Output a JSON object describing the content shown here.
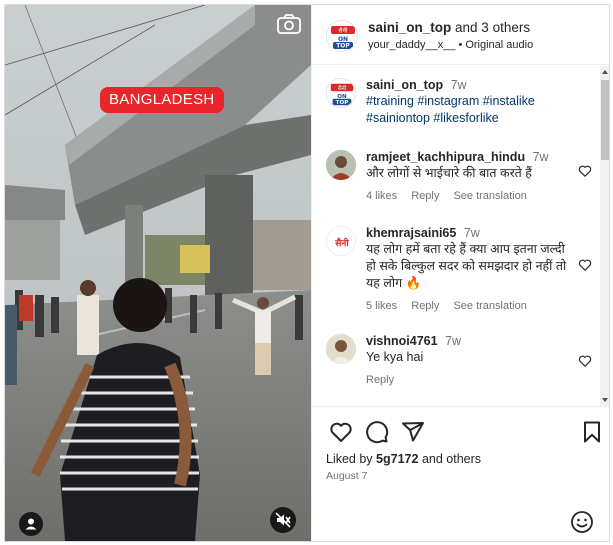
{
  "media": {
    "overlay_label": "BANGLADESH",
    "icons": [
      "camera-icon",
      "user-tag-icon",
      "mute-icon"
    ]
  },
  "header": {
    "username": "saini_on_top",
    "others_text": "and 3 others",
    "audio_user": "your_daddy__x__",
    "audio_separator": "•",
    "audio_label": "Original audio",
    "avatar_lines": [
      "सैनी",
      "ON",
      "TOP"
    ]
  },
  "caption": {
    "username": "saini_on_top",
    "time": "7w",
    "text": "#training #instagram #instalike #sainiontop #likesforlike"
  },
  "comments": [
    {
      "username": "ramjeet_kachhipura_hindu",
      "time": "7w",
      "text": "और लोगों से भाईचारे की बात करते हैं",
      "likes": "4 likes",
      "reply": "Reply",
      "translate": "See translation"
    },
    {
      "username": "khemrajsaini65",
      "time": "7w",
      "text": "यह लोग हमें बता रहे हैं क्या आप इतना जल्दी हो सके बिल्कुल सदर को समझदार हो नहीं तो यह लोग 🔥",
      "likes": "5 likes",
      "reply": "Reply",
      "translate": "See translation",
      "avatar_text": "सैनी"
    },
    {
      "username": "vishnoi4761",
      "time": "7w",
      "text": "Ye kya hai",
      "reply": "Reply"
    }
  ],
  "footer": {
    "likes_prefix": "Liked by",
    "likes_user": "5g7172",
    "likes_suffix": "and others",
    "date": "August 7",
    "actions": [
      "heart-icon",
      "comment-icon",
      "share-icon",
      "bookmark-icon",
      "emoji-icon"
    ]
  },
  "colors": {
    "overlay_red": "#e8262b",
    "hashtag_blue": "#00376b",
    "muted_text": "#737373",
    "brand_red": "#e0262b"
  }
}
